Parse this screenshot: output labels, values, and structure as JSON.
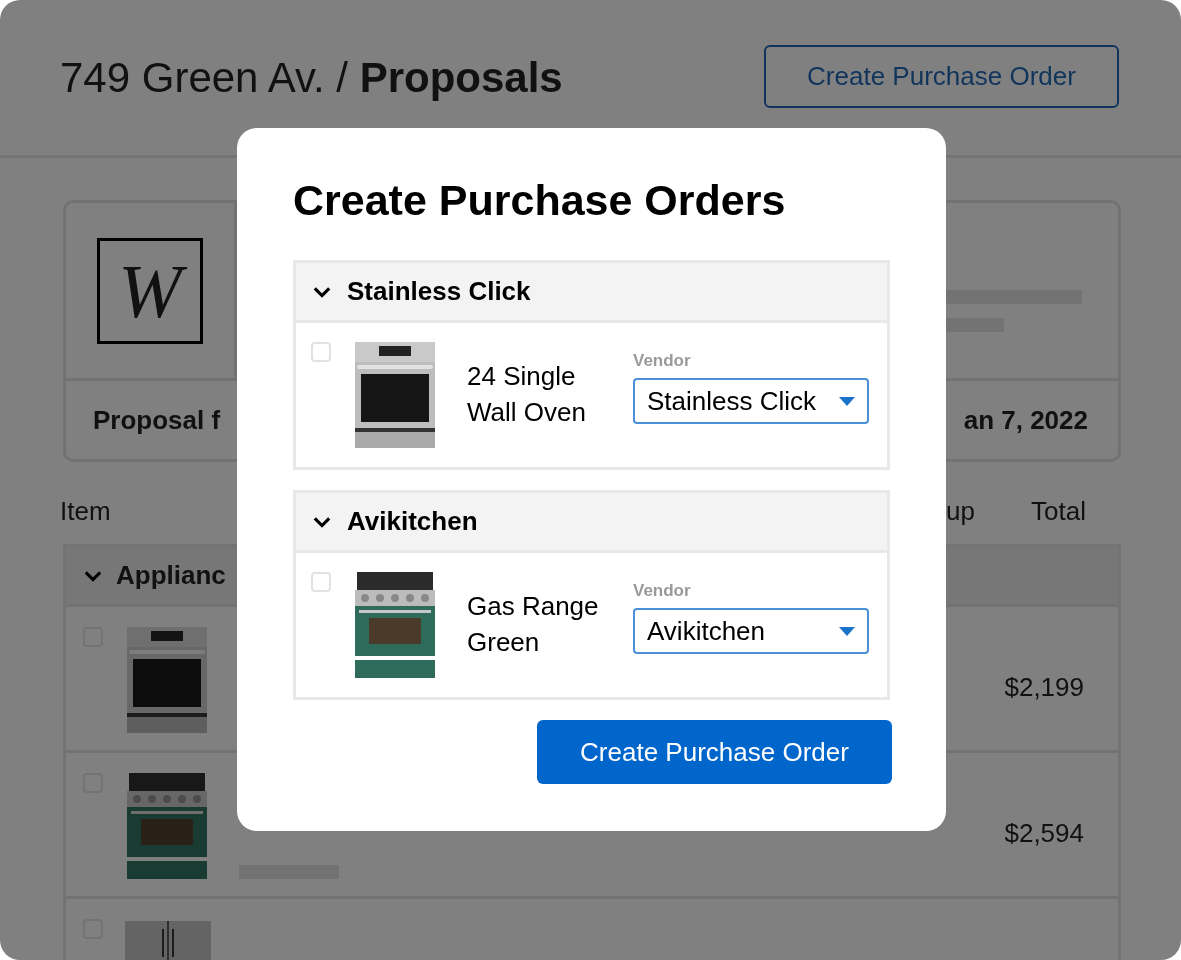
{
  "page": {
    "breadcrumb": "749 Green Av. / **Proposals**",
    "action_button": "Create Purchase Order"
  },
  "proposal_card": {
    "logo_text": "W",
    "title": "Proposal f",
    "date": "an 7, 2022"
  },
  "table": {
    "columns": [
      "Item",
      "up",
      "Total"
    ],
    "groups": [
      {
        "name": "Applianc",
        "expanded": true,
        "rows": [
          {
            "kind": "wall_oven",
            "checked": false,
            "total": "$2,199"
          },
          {
            "kind": "gas_range",
            "checked": false,
            "total": "$2,594"
          },
          {
            "kind": "refrigerator",
            "checked": false
          }
        ]
      }
    ]
  },
  "modal": {
    "title": "Create Purchase Orders",
    "groups": [
      {
        "name": "Stainless Click",
        "expanded": true,
        "items": [
          {
            "kind": "wall_oven",
            "name": "24 Single Wall Oven",
            "checked": false,
            "vendor_label": "Vendor",
            "vendor": "Stainless Click"
          }
        ]
      },
      {
        "name": "Avikitchen",
        "expanded": true,
        "items": [
          {
            "kind": "gas_range",
            "name": "Gas Range Green",
            "checked": false,
            "vendor_label": "Vendor",
            "vendor": "Avikitchen"
          }
        ]
      }
    ],
    "submit_button": "Create Purchase Order"
  }
}
